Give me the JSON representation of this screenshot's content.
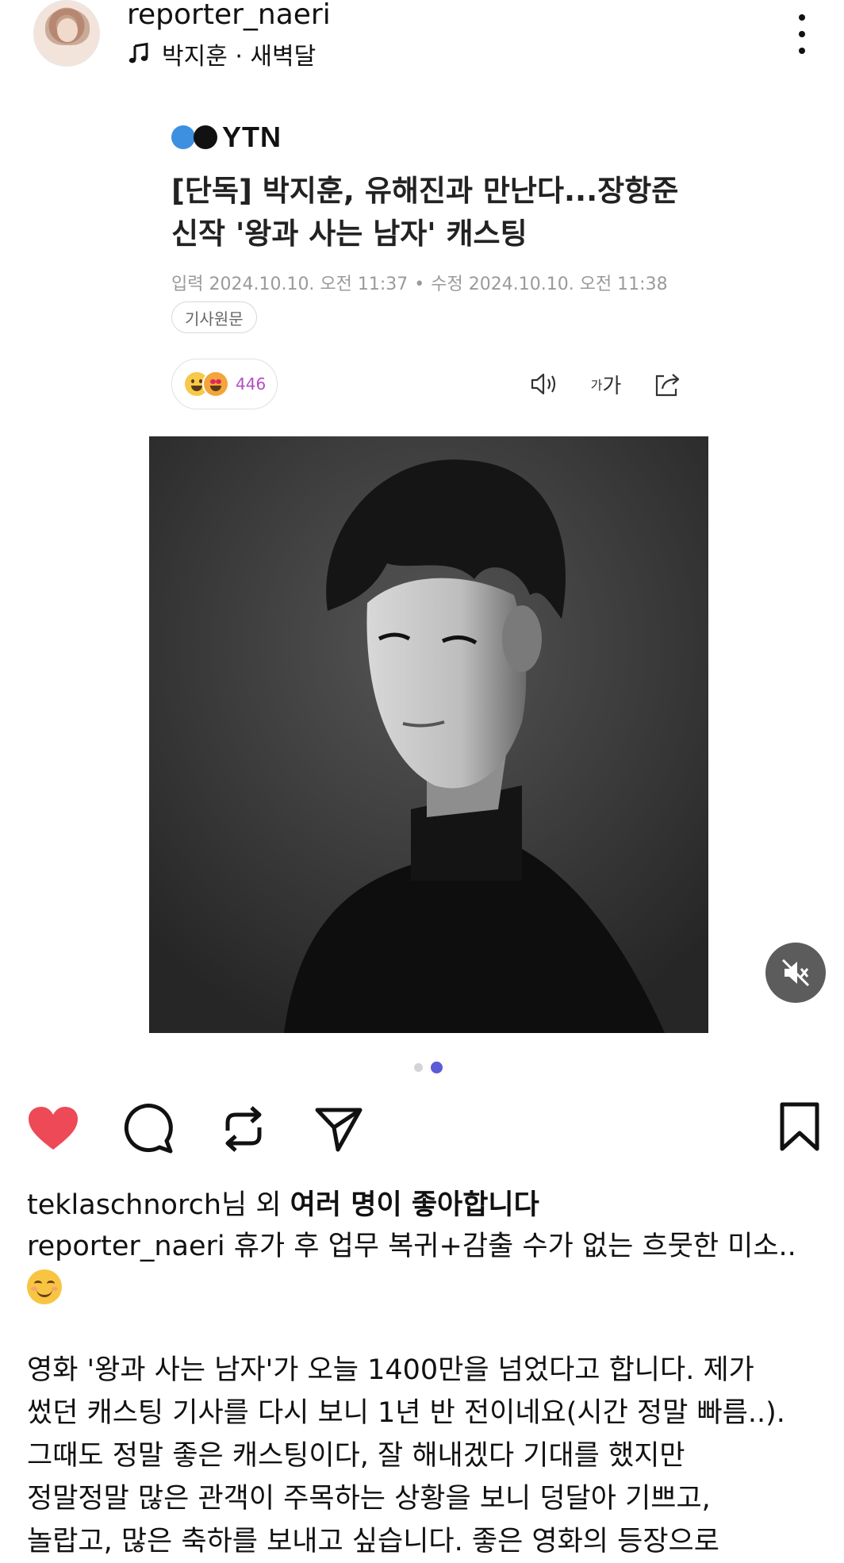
{
  "header": {
    "username": "reporter_naeri",
    "music": "박지훈 · 새벽달"
  },
  "article": {
    "brand": "YTN",
    "headline_line1": "[단독] 박지훈, 유해진과 만난다...장항준",
    "headline_line2": "신작 '왕과 사는 남자' 캐스팅",
    "published": "입력 2024.10.10. 오전 11:37",
    "modified": "수정 2024.10.10. 오전 11:38",
    "original_button": "기사원문",
    "reaction_count": "446",
    "font_tool_small": "가",
    "font_tool_large": "가"
  },
  "carousel": {
    "total": 2,
    "current": 2
  },
  "post": {
    "likes_user": "teklaschnorch",
    "likes_mid": "님 외 ",
    "likes_bold": "여러 명이 좋아합니다",
    "caption_user": "reporter_naeri",
    "caption_text": " 휴가 후 업무 복귀+감출 수가 없는 흐뭇한 미소..",
    "body_lines": [
      "영화 '왕과 사는 남자'가 오늘 1400만을 넘었다고 합니다. 제가",
      "썼던 캐스팅 기사를 다시 보니 1년 반 전이네요(시간 정말 빠름..).",
      "그때도 정말 좋은 캐스팅이다, 잘 해내겠다 기대를 했지만",
      "정말정말 많은 관객이 주목하는 상황을 보니 덩달아 기쁘고,",
      "놀랍고, 많은 축하를 보내고 싶습니다. 좋은 영화의 등장으로"
    ]
  },
  "icons": {
    "more": "more-vertical-icon",
    "music": "music-note-icon",
    "speaker": "speaker-icon",
    "share": "share-icon",
    "mute": "muted-speaker-icon",
    "like": "heart-icon",
    "comment": "comment-icon",
    "repost": "repost-icon",
    "send": "paper-plane-icon",
    "save": "bookmark-icon",
    "smile": "smiling-face-emoji"
  },
  "colors": {
    "like": "#ed4956",
    "pager_active": "#5b5bd6",
    "ytn_blue": "#3d8fe0",
    "reaction_count": "#b44ec0"
  }
}
